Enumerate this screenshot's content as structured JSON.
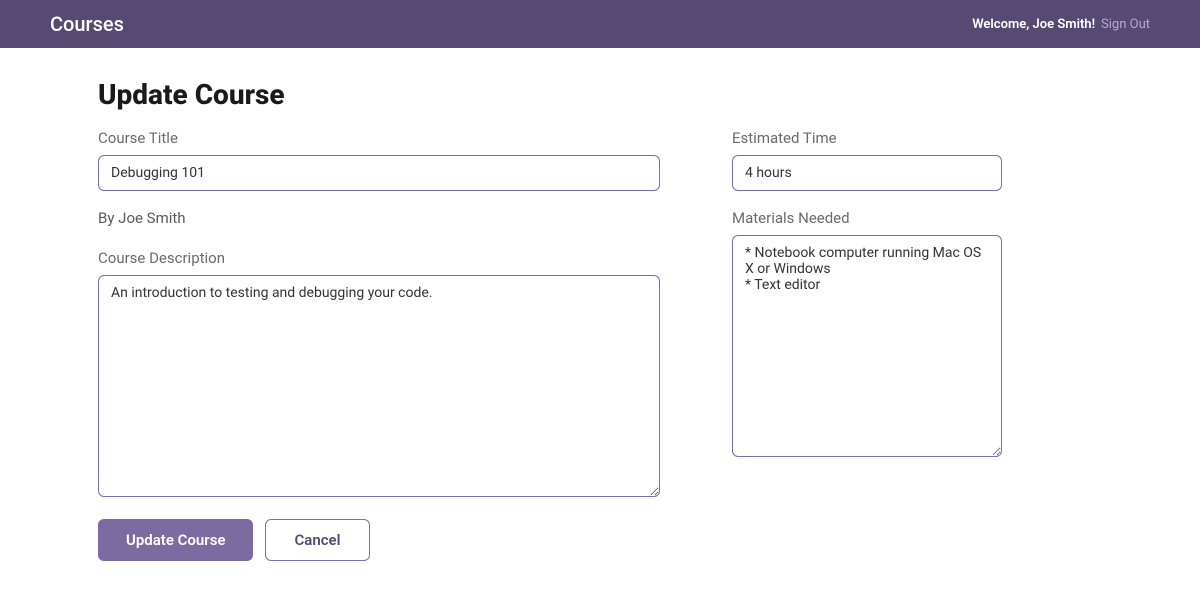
{
  "header": {
    "brand": "Courses",
    "welcome": "Welcome, Joe Smith!",
    "signout": "Sign Out"
  },
  "page": {
    "title": "Update Course"
  },
  "form": {
    "courseTitle": {
      "label": "Course Title",
      "value": "Debugging 101"
    },
    "byline": "By Joe Smith",
    "description": {
      "label": "Course Description",
      "value": "An introduction to testing and debugging your code."
    },
    "estimatedTime": {
      "label": "Estimated Time",
      "value": "4 hours"
    },
    "materialsNeeded": {
      "label": "Materials Needed",
      "value": "* Notebook computer running Mac OS X or Windows\n* Text editor"
    },
    "buttons": {
      "submit": "Update Course",
      "cancel": "Cancel"
    }
  }
}
